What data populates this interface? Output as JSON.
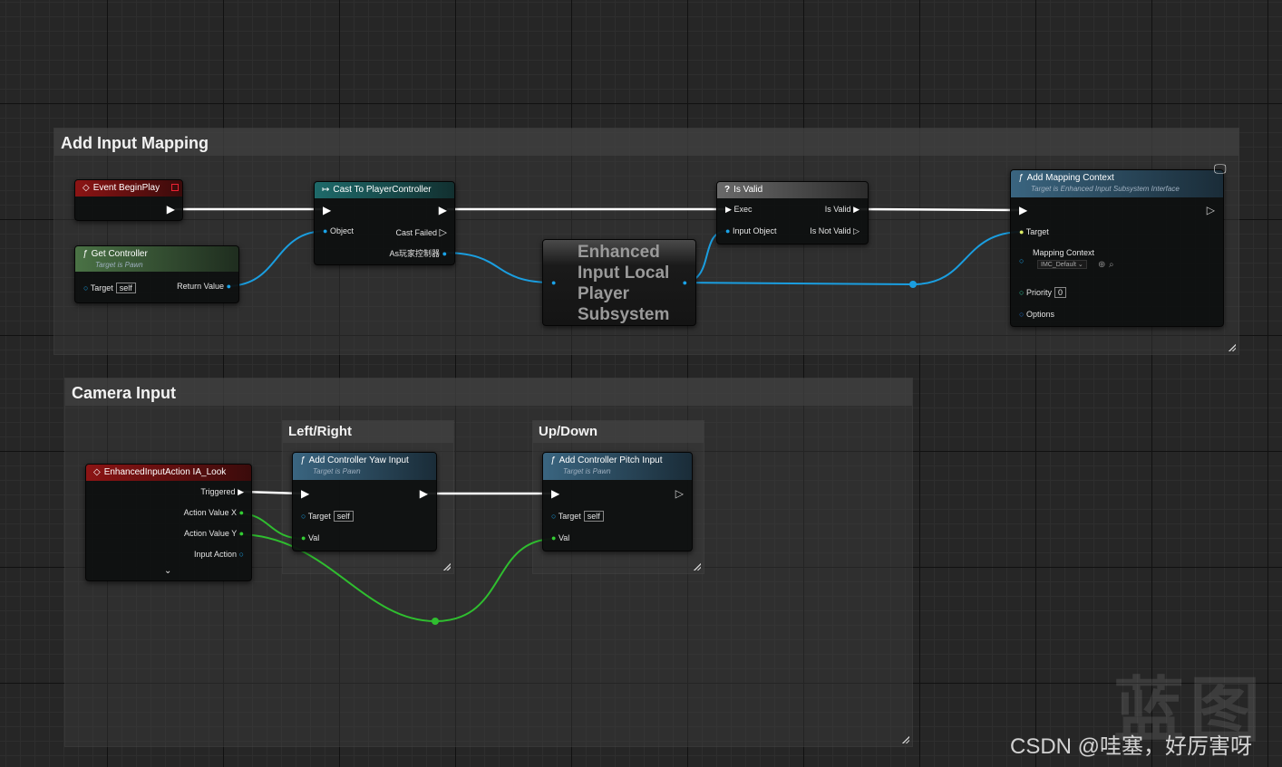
{
  "colors": {
    "exec": "#ffffff",
    "object": "#1aa3e8",
    "float": "#33cc33",
    "struct": "#1aa3e8",
    "bool": "#ddee66"
  },
  "comments": {
    "add_input_mapping": "Add Input Mapping",
    "camera_input": "Camera Input",
    "left_right": "Left/Right",
    "up_down": "Up/Down"
  },
  "nodes": {
    "event_begin_play": {
      "title": "Event BeginPlay",
      "icon": "event-diamond-icon"
    },
    "get_controller": {
      "title": "Get Controller",
      "subtitle": "Target is Pawn",
      "target": "Target",
      "target_value": "self",
      "return": "Return Value"
    },
    "cast_to_pc": {
      "title": "Cast To PlayerController",
      "object": "Object",
      "cast_failed": "Cast Failed",
      "as_pc": "As玩家控制器"
    },
    "is_valid": {
      "title": "Is Valid",
      "exec": "Exec",
      "is_valid": "Is Valid",
      "input_object": "Input Object",
      "is_not_valid": "Is Not Valid"
    },
    "subsystem": {
      "title_lines": [
        "Enhanced",
        "Input Local",
        "Player",
        "Subsystem"
      ]
    },
    "add_mapping": {
      "title": "Add Mapping Context",
      "subtitle": "Target is Enhanced Input Subsystem Interface",
      "target": "Target",
      "mapping_context": "Mapping Context",
      "mapping_value": "IMC_Default",
      "priority": "Priority",
      "priority_value": "0",
      "options": "Options"
    },
    "ia_look": {
      "title": "EnhancedInputAction IA_Look",
      "triggered": "Triggered",
      "action_x": "Action Value X",
      "action_y": "Action Value Y",
      "input_action": "Input Action"
    },
    "yaw": {
      "title": "Add Controller Yaw Input",
      "subtitle": "Target is Pawn",
      "target": "Target",
      "target_value": "self",
      "val": "Val"
    },
    "pitch": {
      "title": "Add Controller Pitch Input",
      "subtitle": "Target is Pawn",
      "target": "Target",
      "target_value": "self",
      "val": "Val"
    }
  },
  "watermark": {
    "text": "CSDN @哇塞，好厉害呀",
    "logo": "蓝图"
  }
}
